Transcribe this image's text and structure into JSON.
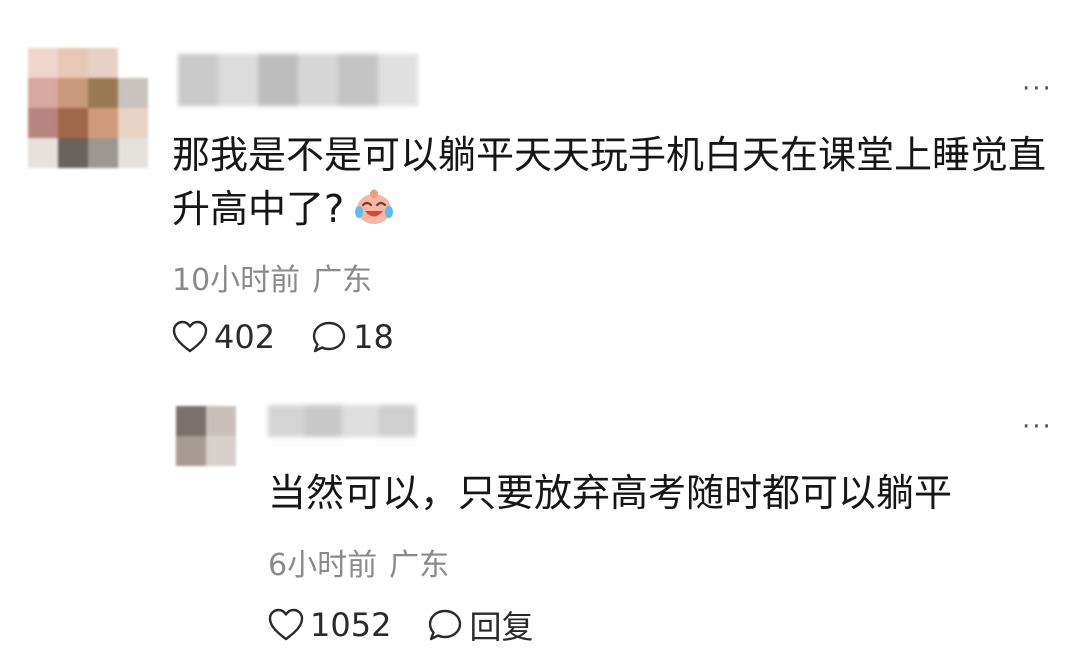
{
  "comment": {
    "text": "那我是不是可以躺平天天玩手机白天在课堂上睡觉直升高中了?",
    "emoji": "crying-laughing-emoji",
    "time": "10小时前",
    "location": "广东",
    "likes": "402",
    "replies": "18",
    "avatar_colors": [
      "#f1d4cc",
      "#e8c7b4",
      "#e8d0c4",
      "#ffffff",
      "#d8a7a0",
      "#c9977a",
      "#9a7a54",
      "#c9c3bd",
      "#b88580",
      "#a0684a",
      "#d09a7c",
      "#e8d2c4",
      "#e8e0dc",
      "#6a625e",
      "#9c9790",
      "#e4e0dc"
    ],
    "name_colors": [
      "#c9c9c9",
      "#dcdcdc",
      "#bdbdbd",
      "#d6d6d6",
      "#c4c4c4",
      "#e0e0e0"
    ]
  },
  "reply": {
    "text": "当然可以，只要放弃高考随时都可以躺平",
    "time": "6小时前",
    "location": "广东",
    "likes": "1052",
    "reply_label": "回复",
    "avatar_colors": [
      "#7a706c",
      "#c9bfba",
      "#a89a94",
      "#d8d0cc"
    ],
    "name_colors": [
      "#d4d4d4",
      "#c8c8c8",
      "#dedede",
      "#cfcfcf"
    ]
  },
  "icons": {
    "like": "heart-outline-icon",
    "comment": "speech-bubble-icon",
    "more": "more-dots-icon"
  },
  "more_label": "···"
}
